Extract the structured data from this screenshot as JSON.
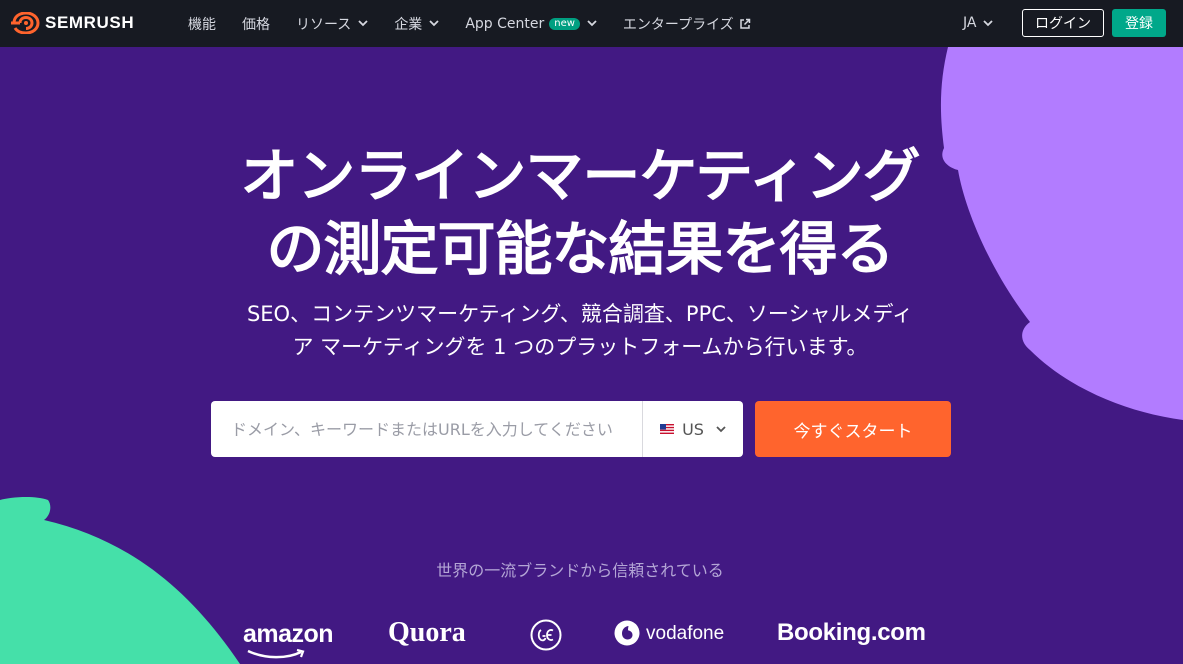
{
  "nav": {
    "logo_text": "SEMRUSH",
    "items": [
      {
        "label": "機能",
        "dropdown": false
      },
      {
        "label": "価格",
        "dropdown": false
      },
      {
        "label": "リソース",
        "dropdown": true
      },
      {
        "label": "企業",
        "dropdown": true
      },
      {
        "label": "App Center",
        "dropdown": true,
        "badge": "new"
      },
      {
        "label": "エンタープライズ",
        "external": true
      }
    ],
    "lang": "JA",
    "login_label": "ログイン",
    "signup_label": "登録"
  },
  "hero": {
    "title_line1": "オンラインマーケティング",
    "title_line2": "の測定可能な結果を得る",
    "subtitle_line1": "SEO、コンテンツマーケティング、競合調査、PPC、ソーシャルメディ",
    "subtitle_line2": "ア マーケティングを 1 つのプラットフォームから行います。"
  },
  "search": {
    "placeholder": "ドメイン、キーワードまたはURLを入力してください",
    "value": "",
    "country": "US",
    "flag_icon": "us-flag-icon",
    "cta_label": "今すぐスタート"
  },
  "brands": {
    "heading": "世界の一流ブランドから信頼されている",
    "items": [
      "amazon",
      "Quora",
      "GE",
      "vodafone",
      "Booking.com"
    ]
  },
  "colors": {
    "nav_bg": "#171a22",
    "hero_bg": "#421983",
    "accent_orange": "#ff642d",
    "accent_green": "#00a88a",
    "blob_purple": "#b27cff",
    "blob_green": "#45e0a9"
  }
}
